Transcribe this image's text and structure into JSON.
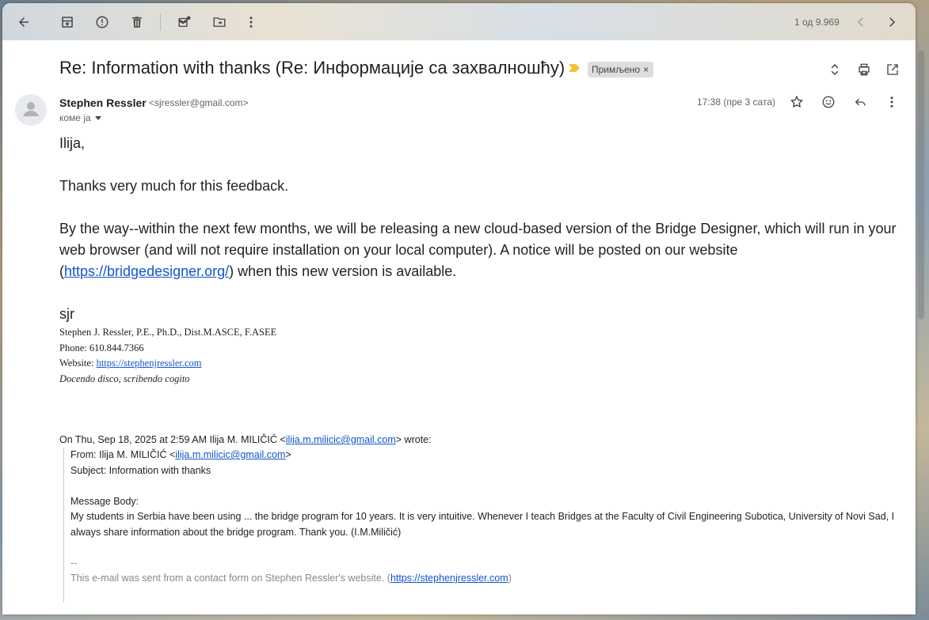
{
  "toolbar": {
    "buttons": [
      "back-icon",
      "archive-icon",
      "report-spam-icon",
      "delete-icon",
      "mark-unread-icon",
      "move-to-icon",
      "more-vert-icon"
    ],
    "pager": "1 од 9.969"
  },
  "email": {
    "subject": "Re: Information with thanks (Re: Информације са захвалношћу)",
    "label": "Примљено",
    "label_close": "×",
    "sender_name": "Stephen Ressler",
    "sender_email": "<sjressler@gmail.com>",
    "recipient": "коме ја",
    "date": "17:38 (пре 3 сата)"
  },
  "body": {
    "greeting": "Ilija,",
    "p1": "Thanks very much for this feedback.",
    "p2_before": "By the way--within the next few months, we will be releasing a new cloud-based version of the Bridge Designer, which will run in your web browser (and will not require installation on your local computer).  A notice will be posted on our website (",
    "p2_link": "https://bridgedesigner.org/",
    "p2_after": ") when this new version is available.",
    "signoff": "sjr",
    "sig_name": "Stephen J. Ressler, P.E., Ph.D., Dist.M.ASCE, F.ASEE",
    "sig_phone": "Phone: 610.844.7366",
    "sig_website_label": "Website: ",
    "sig_website": "https://stephenjressler.com",
    "sig_motto": "Docendo disco, scribendo cogito"
  },
  "quote": {
    "header_before": "On Thu, Sep 18, 2025 at 2:59 AM Ilija M. MILIČIĆ <",
    "header_email": "ilija.m.milicic@gmail.com",
    "header_after": "> wrote:",
    "from_before": "From: Ilija M. MILIČIĆ <",
    "from_email": "ilija.m.milicic@gmail.com",
    "from_after": ">",
    "subject": "Subject: Information with thanks",
    "body_label": "Message Body:",
    "body_text": "My students in Serbia have been using ... the bridge program for 10 years. It is very intuitive. Whenever I teach Bridges at the Faculty of Civil Engineering Subotica, University of Novi Sad, I always share information about the bridge program. Thank you. (I.M.Miličić)",
    "dashes": "--",
    "footer_before": "This e-mail was sent from a contact form on Stephen Ressler's website. (",
    "footer_link": "https://stephenjressler.com",
    "footer_after": ")"
  },
  "colors": {
    "link": "#1155cc",
    "importance": "#f2c230",
    "chip_bg": "#dddddd"
  }
}
